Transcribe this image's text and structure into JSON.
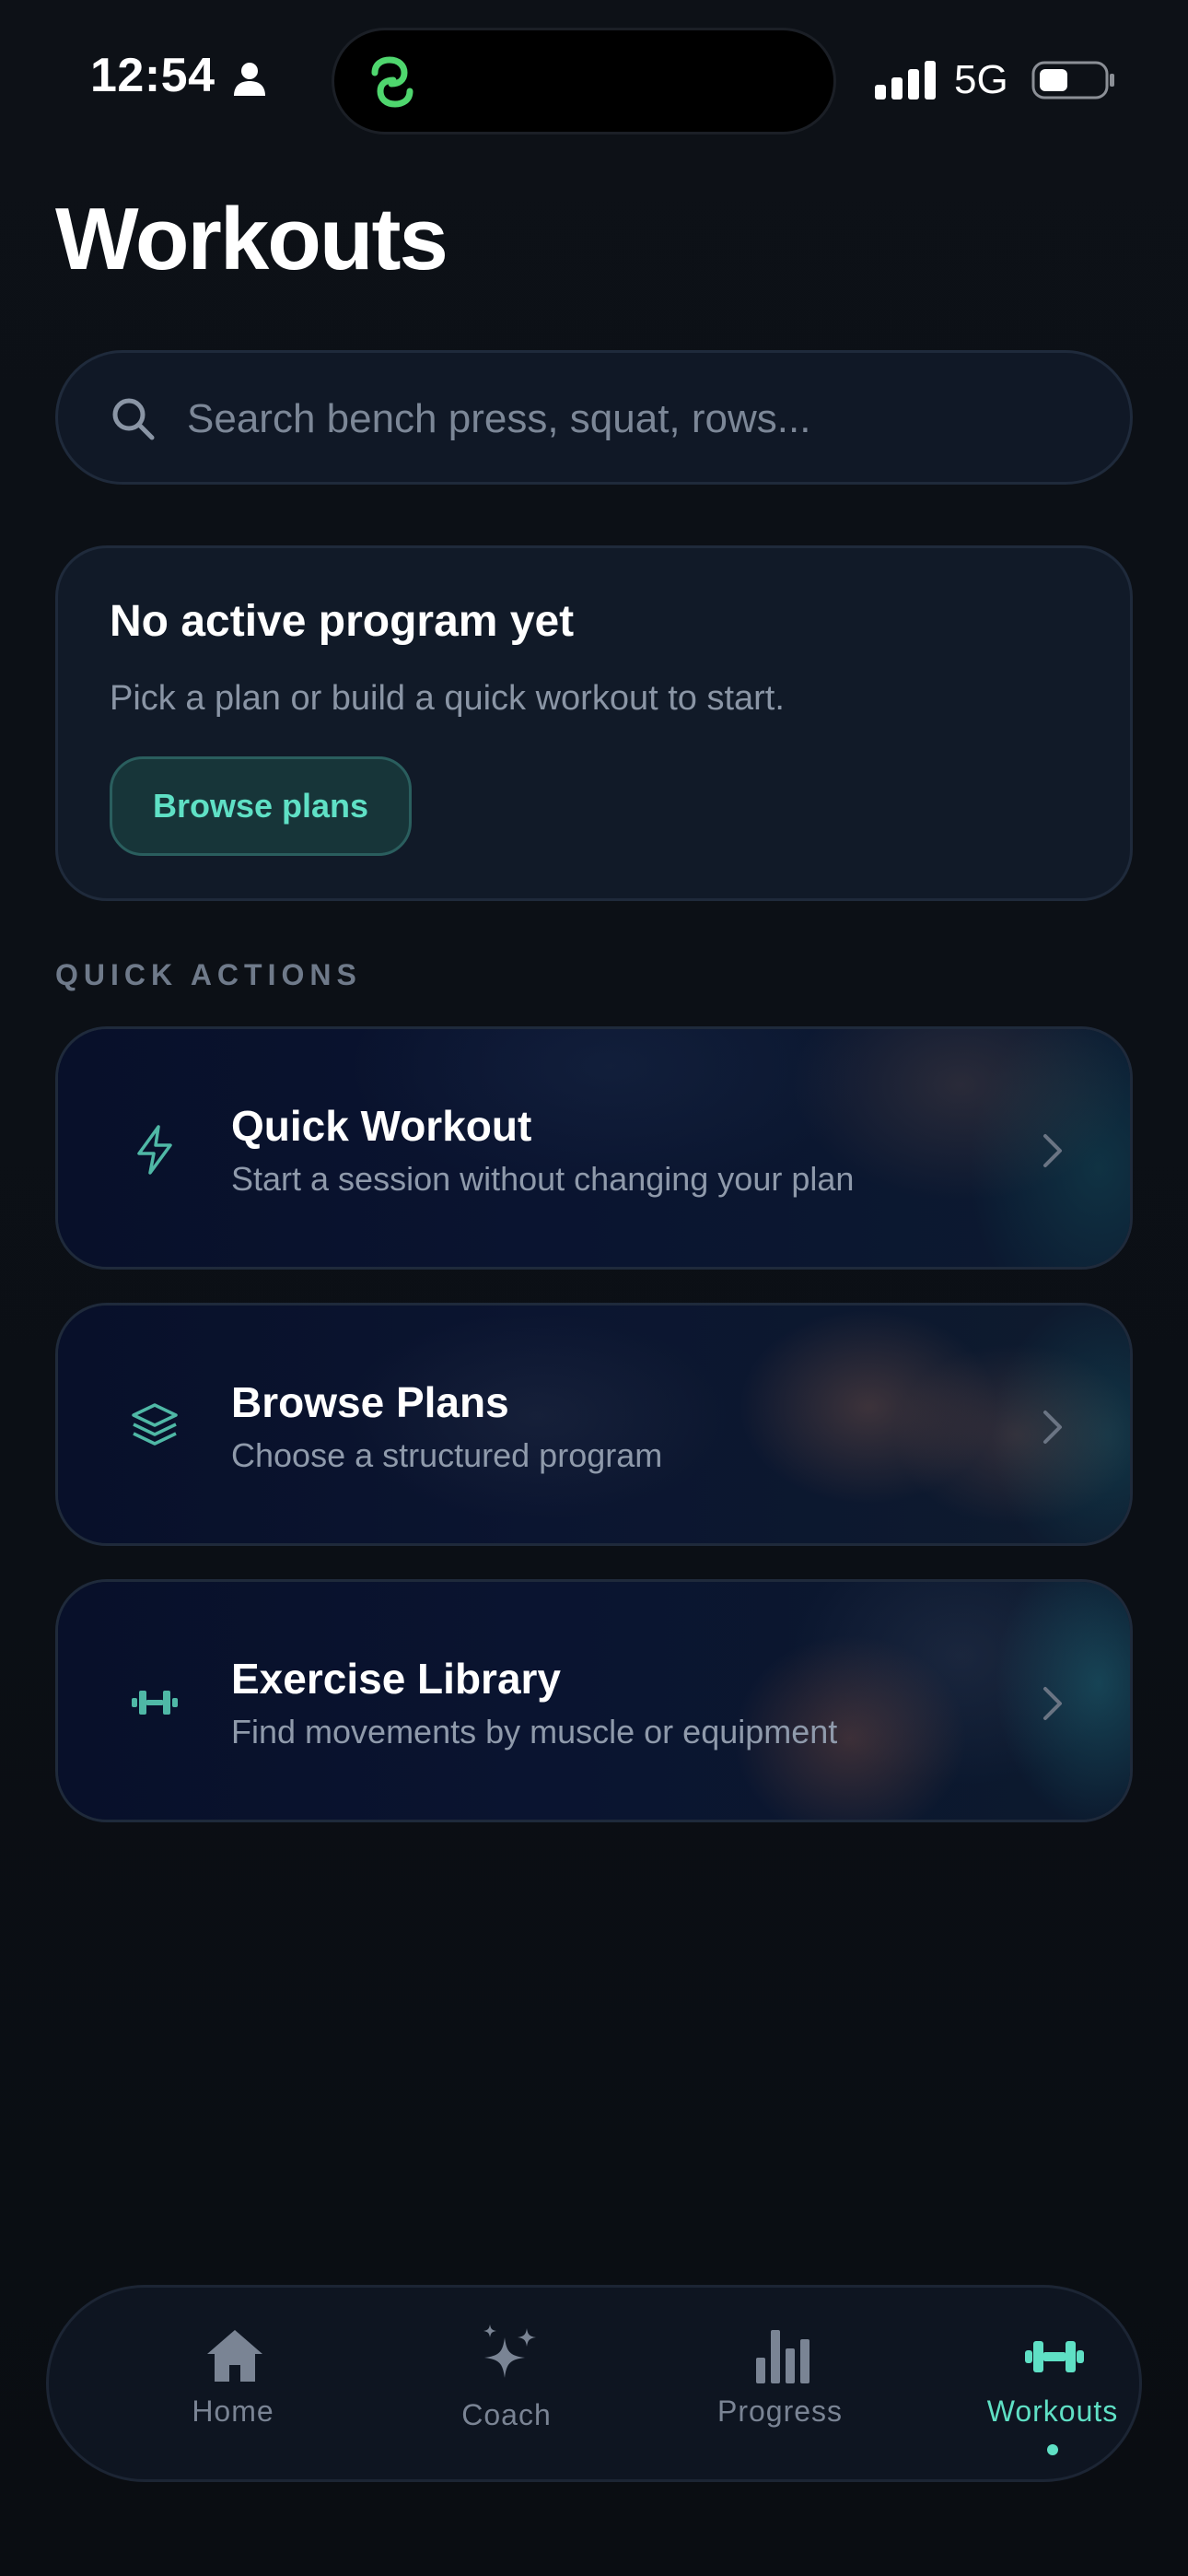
{
  "status_bar": {
    "time": "12:54",
    "network": "5G",
    "icons": [
      "person-icon",
      "app-link-icon",
      "signal-icon",
      "battery-icon"
    ]
  },
  "page_title": "Workouts",
  "search": {
    "placeholder": "Search bench press, squat, rows..."
  },
  "program_card": {
    "title": "No active program yet",
    "subtitle": "Pick a plan or build a quick workout to start.",
    "button_label": "Browse plans"
  },
  "quick_actions": {
    "section_label": "QUICK ACTIONS",
    "items": [
      {
        "title": "Quick Workout",
        "description": "Start a session without changing your plan",
        "icon": "lightning-icon"
      },
      {
        "title": "Browse Plans",
        "description": "Choose a structured program",
        "icon": "layers-icon"
      },
      {
        "title": "Exercise Library",
        "description": "Find movements by muscle or equipment",
        "icon": "dumbbell-icon"
      }
    ]
  },
  "tab_bar": {
    "active": "Workouts",
    "items": [
      {
        "label": "Home",
        "icon": "home-icon"
      },
      {
        "label": "Coach",
        "icon": "sparkles-icon"
      },
      {
        "label": "Progress",
        "icon": "bar-chart-icon"
      },
      {
        "label": "Workouts",
        "icon": "dumbbell-icon"
      }
    ]
  },
  "colors": {
    "background": "#0c1015",
    "accent": "#5fe0c5",
    "card": "#111a28",
    "muted_text": "#8a95a5"
  }
}
